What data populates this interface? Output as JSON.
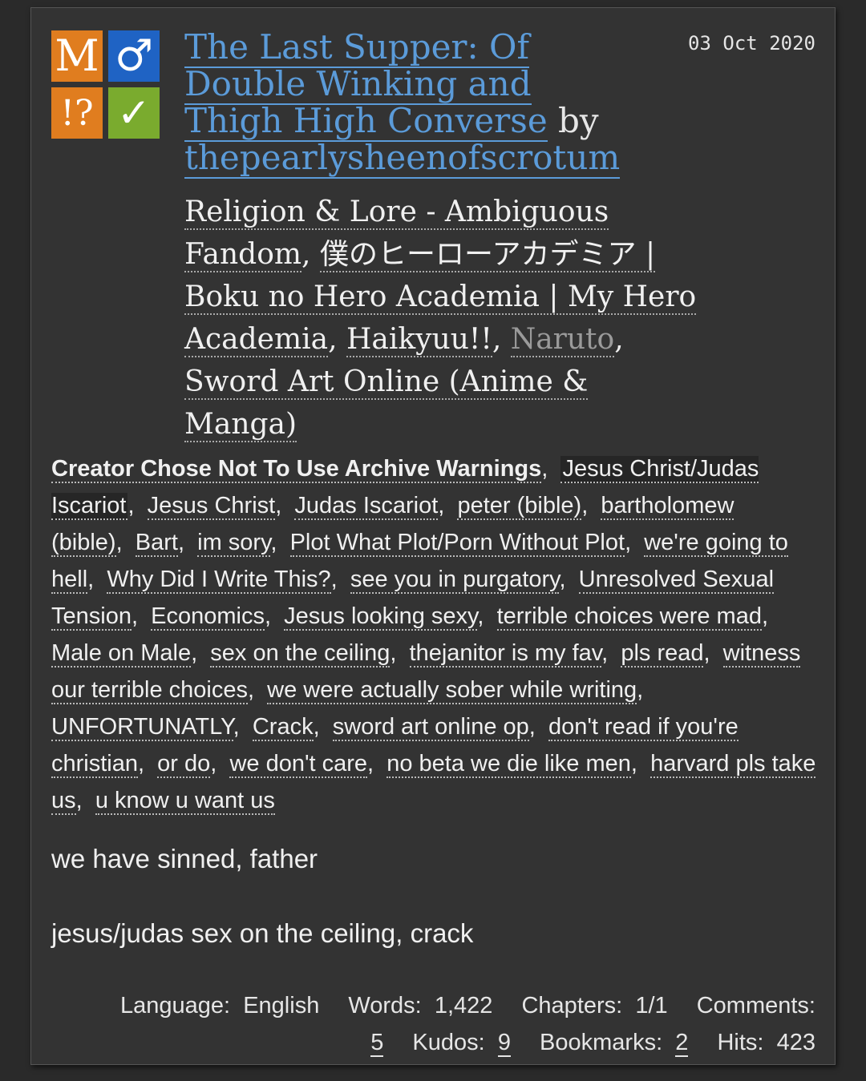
{
  "work": {
    "title": "The Last Supper: Of Double Winking and Thigh High Converse",
    "by": "by",
    "author": "thepearlysheenofscrotum",
    "date": "03 Oct 2020"
  },
  "required_tags": {
    "rating": "M",
    "category": "♂",
    "warning": "!?",
    "complete": "✓"
  },
  "fandoms": [
    {
      "name": "Religion & Lore - Ambiguous Fandom",
      "sep": ", "
    },
    {
      "name": "僕のヒーローアカデミア | Boku no Hero Academia | My Hero Academia",
      "sep": ", "
    },
    {
      "name": "Haikyuu!!",
      "sep": ", "
    },
    {
      "name": "Naruto",
      "sep": ","
    },
    {
      "name": "Sword Art Online (Anime & Manga)",
      "sep": ""
    }
  ],
  "tags": [
    "Creator Chose Not To Use Archive Warnings",
    "Jesus Christ/Judas Iscariot",
    "Jesus Christ",
    "Judas Iscariot",
    "peter (bible)",
    "bartholomew (bible)",
    "Bart",
    "im sory",
    "Plot What Plot/Porn Without Plot",
    "we're going to hell",
    "Why Did I Write This?",
    "see you in purgatory",
    "Unresolved Sexual Tension",
    "Economics",
    "Jesus looking sexy",
    "terrible choices were mad",
    "Male on Male",
    "sex on the ceiling",
    "thejanitor is my fav",
    "pls read",
    "witness our terrible choices",
    "we were actually sober while writing",
    "UNFORTUNATLY",
    "Crack",
    "sword art online op",
    "don't read if you're christian",
    "or do",
    "we don't care",
    "no beta we die like men",
    "harvard pls take us",
    "u know u want us"
  ],
  "summary": [
    "we have sinned, father",
    "jesus/judas sex on the ceiling, crack"
  ],
  "stats": {
    "language_label": "Language:",
    "language": "English",
    "words_label": "Words:",
    "words": "1,422",
    "chapters_label": "Chapters:",
    "chapters": "1/1",
    "comments_label": "Comments:",
    "comments": "5",
    "kudos_label": "Kudos:",
    "kudos": "9",
    "bookmarks_label": "Bookmarks:",
    "bookmarks": "2",
    "hits_label": "Hits:",
    "hits": "423"
  },
  "colors": {
    "link": "#5b9bd9",
    "rating_bg": "#e07d1f",
    "category_bg": "#1f63c4",
    "complete_bg": "#7aab2e"
  }
}
